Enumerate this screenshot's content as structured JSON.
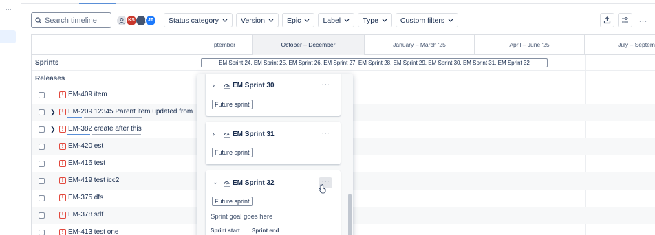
{
  "toolbar": {
    "search_placeholder": "Search timeline",
    "avatar_initials": "KS",
    "avatar_initials_2": "JT",
    "filters": [
      "Status category",
      "Version",
      "Epic",
      "Label",
      "Type",
      "Custom filters"
    ]
  },
  "timeline": {
    "months": [
      "ptember",
      "October – December",
      "January – March '25",
      "April – June '25",
      "July – Septem"
    ],
    "sprints_label": "Sprints",
    "releases_label": "Releases",
    "sprint_bar": "EM Sprint 24, EM Sprint 25, EM Sprint 26, EM Sprint 27, EM Sprint 28, EM Sprint 29, EM Sprint 30, EM Sprint 31, EM Sprint 32"
  },
  "items": [
    {
      "text": "EM-409 item",
      "expand": false
    },
    {
      "text": "EM-209 12345 Parent item updated from ...",
      "expand": true
    },
    {
      "text": "EM-382 create after this",
      "expand": true
    },
    {
      "text": "EM-420 est",
      "expand": false
    },
    {
      "text": "EM-416 test",
      "expand": false
    },
    {
      "text": "EM-419 test icc2",
      "expand": false
    },
    {
      "text": "EM-375 dfs",
      "expand": false
    },
    {
      "text": "EM-378 sdf",
      "expand": false
    },
    {
      "text": "EM-413 test one",
      "expand": false
    }
  ],
  "popup": {
    "cards": [
      {
        "title": "EM Sprint 30",
        "status": "Future sprint",
        "chevron": "›"
      },
      {
        "title": "EM Sprint 31",
        "status": "Future sprint",
        "chevron": "›"
      },
      {
        "title": "EM Sprint 32",
        "status": "Future sprint",
        "chevron": "⌄",
        "goal": "Sprint goal goes here",
        "start_label": "Sprint start",
        "end_label": "Sprint end"
      }
    ],
    "more": "···"
  },
  "colors": {
    "bug": "#e2483d",
    "progress_done": "#5a8fd7",
    "progress_rest": "#a5adba"
  }
}
